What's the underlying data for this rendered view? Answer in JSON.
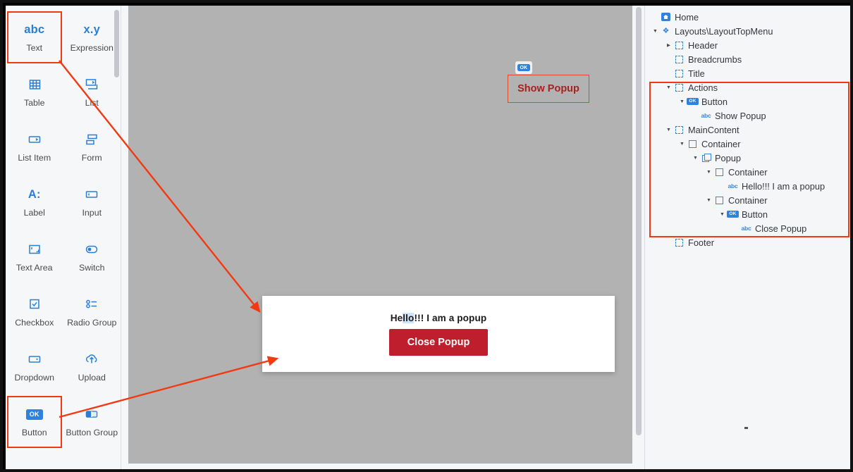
{
  "palette": {
    "items": [
      {
        "label": "Text",
        "icon": "abc-text-icon",
        "icon_text": "abc",
        "selected": true
      },
      {
        "label": "Expression",
        "icon": "expression-icon",
        "icon_text": "x.y",
        "selected": false
      },
      {
        "label": "Table",
        "icon": "table-icon",
        "icon_text": "",
        "selected": false
      },
      {
        "label": "List",
        "icon": "list-icon",
        "icon_text": "",
        "selected": false
      },
      {
        "label": "List Item",
        "icon": "list-item-icon",
        "icon_text": "",
        "selected": false
      },
      {
        "label": "Form",
        "icon": "form-icon",
        "icon_text": "",
        "selected": false
      },
      {
        "label": "Label",
        "icon": "label-icon",
        "icon_text": "A:",
        "selected": false
      },
      {
        "label": "Input",
        "icon": "input-icon",
        "icon_text": "",
        "selected": false
      },
      {
        "label": "Text Area",
        "icon": "text-area-icon",
        "icon_text": "",
        "selected": false
      },
      {
        "label": "Switch",
        "icon": "switch-icon",
        "icon_text": "",
        "selected": false
      },
      {
        "label": "Checkbox",
        "icon": "checkbox-icon",
        "icon_text": "",
        "selected": false
      },
      {
        "label": "Radio Group",
        "icon": "radio-group-icon",
        "icon_text": "",
        "selected": false
      },
      {
        "label": "Dropdown",
        "icon": "dropdown-icon",
        "icon_text": "",
        "selected": false
      },
      {
        "label": "Upload",
        "icon": "upload-icon",
        "icon_text": "",
        "selected": false
      },
      {
        "label": "Button",
        "icon": "button-ok-icon",
        "icon_text": "OK",
        "selected": true
      },
      {
        "label": "Button Group",
        "icon": "button-group-icon",
        "icon_text": "",
        "selected": false
      }
    ]
  },
  "canvas": {
    "show_popup_button": {
      "label": "Show Popup",
      "badge": "OK"
    },
    "popup": {
      "message_prefix": "He",
      "message_highlight": "llo",
      "message_suffix": "!!! I am a popup",
      "message_full": "Hello!!! I am a popup",
      "close_button_label": "Close Popup"
    }
  },
  "tree": {
    "nodes": [
      {
        "label": "Home",
        "indent": 0,
        "caret": "none",
        "icon": "home-icon"
      },
      {
        "label": "Layouts\\LayoutTopMenu",
        "indent": 0,
        "caret": "down",
        "icon": "puzzle-icon"
      },
      {
        "label": "Header",
        "indent": 1,
        "caret": "right",
        "icon": "dashed-box-icon"
      },
      {
        "label": "Breadcrumbs",
        "indent": 1,
        "caret": "none",
        "icon": "dashed-box-icon"
      },
      {
        "label": "Title",
        "indent": 1,
        "caret": "none",
        "icon": "dashed-box-icon"
      },
      {
        "label": "Actions",
        "indent": 1,
        "caret": "down",
        "icon": "dashed-box-icon"
      },
      {
        "label": "Button",
        "indent": 2,
        "caret": "down",
        "icon": "ok-badge-icon"
      },
      {
        "label": "Show Popup",
        "indent": 3,
        "caret": "none",
        "icon": "abc-icon"
      },
      {
        "label": "MainContent",
        "indent": 1,
        "caret": "down",
        "icon": "dashed-box-icon"
      },
      {
        "label": "Container",
        "indent": 2,
        "caret": "down",
        "icon": "solid-box-icon"
      },
      {
        "label": "Popup",
        "indent": 3,
        "caret": "down",
        "icon": "popup-layers-icon"
      },
      {
        "label": "Container",
        "indent": 4,
        "caret": "down",
        "icon": "solid-box-icon"
      },
      {
        "label": "Hello!!! I am a popup",
        "indent": 5,
        "caret": "none",
        "icon": "abc-icon"
      },
      {
        "label": "Container",
        "indent": 4,
        "caret": "down",
        "icon": "solid-box-icon"
      },
      {
        "label": "Button",
        "indent": 5,
        "caret": "down",
        "icon": "ok-badge-icon"
      },
      {
        "label": "Close Popup",
        "indent": 6,
        "caret": "none",
        "icon": "abc-icon"
      },
      {
        "label": "Footer",
        "indent": 1,
        "caret": "none",
        "icon": "dashed-box-icon"
      }
    ]
  },
  "annotations": {
    "highlight_color": "#f23a12",
    "arrow_color": "#f23a12"
  },
  "colors": {
    "accent_blue": "#2a7fd4",
    "canvas_gray": "#b2b2b2",
    "popup_button_red": "#bf1e2d",
    "show_popup_text": "#a82020"
  }
}
